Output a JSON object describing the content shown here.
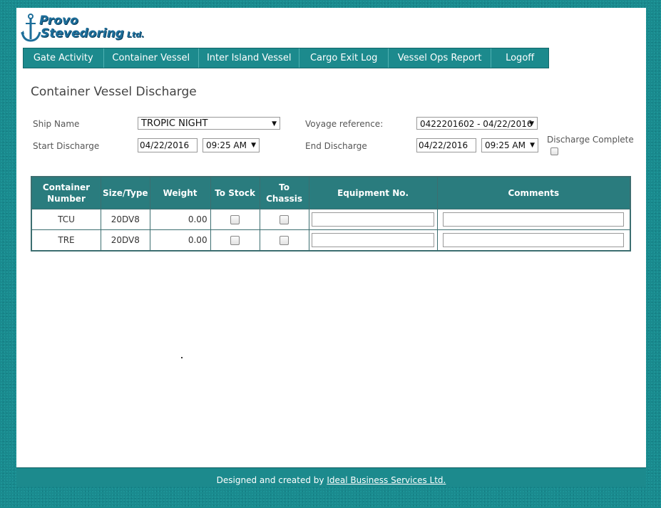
{
  "logo": {
    "line1": "Provo",
    "line2": "Stevedoring",
    "ltd": "Ltd."
  },
  "nav": [
    {
      "label": "Gate Activity"
    },
    {
      "label": "Container Vessel"
    },
    {
      "label": "Inter Island Vessel"
    },
    {
      "label": "Cargo Exit Log"
    },
    {
      "label": "Vessel Ops Report"
    },
    {
      "label": "Logoff"
    }
  ],
  "page": {
    "title": "Container Vessel Discharge"
  },
  "form": {
    "ship_name_label": "Ship Name",
    "ship_name_value": "TROPIC NIGHT",
    "voyage_label": "Voyage reference:",
    "voyage_value": "0422201602 - 04/22/2016",
    "start_label": "Start Discharge",
    "start_date": "04/22/2016",
    "start_time": "09:25 AM",
    "end_label": "End Discharge",
    "end_date": "04/22/2016",
    "end_time": "09:25 AM",
    "complete_label": "Discharge Complete"
  },
  "table": {
    "headers": {
      "container_number_1": "Container",
      "container_number_2": "Number",
      "size_type": "Size/Type",
      "weight": "Weight",
      "to_stock": "To Stock",
      "to_chassis_1": "To",
      "to_chassis_2": "Chassis",
      "equipment": "Equipment No.",
      "comments": "Comments"
    },
    "rows": [
      {
        "container": "TCU",
        "size_type": "20DV8",
        "weight": "0.00"
      },
      {
        "container": "TRE",
        "size_type": "20DV8",
        "weight": "0.00"
      }
    ]
  },
  "footer": {
    "text": "Designed and created by ",
    "link": "Ideal Business Services Ltd."
  },
  "colors": {
    "teal": "#1c8a8d",
    "header": "#2a7c7e",
    "logo_blue": "#1d6e9a"
  }
}
